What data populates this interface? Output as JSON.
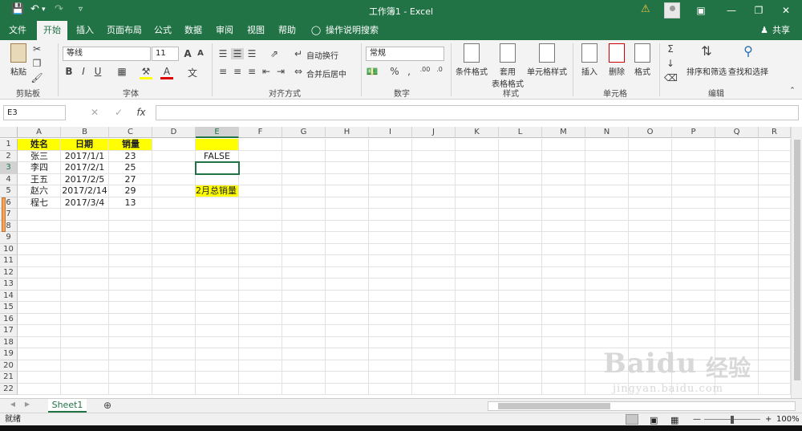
{
  "window": {
    "title": "工作簿1 - Excel"
  },
  "tabs": [
    {
      "label": "文件"
    },
    {
      "label": "开始"
    },
    {
      "label": "插入"
    },
    {
      "label": "页面布局"
    },
    {
      "label": "公式"
    },
    {
      "label": "数据"
    },
    {
      "label": "审阅"
    },
    {
      "label": "视图"
    },
    {
      "label": "帮助"
    }
  ],
  "tellme": "操作说明搜索",
  "share": "共享",
  "ribbon": {
    "paste": "粘贴",
    "clipboard": "剪贴板",
    "font_name": "等线",
    "font_size": "11",
    "font_group": "字体",
    "wrap": "自动换行",
    "merge": "合并后居中",
    "align_group": "对齐方式",
    "numfmt": "常规",
    "number_group": "数字",
    "cond_format": "条件格式",
    "table_format_1": "套用",
    "table_format_2": "表格格式",
    "cell_style": "单元格样式",
    "styles_group": "样式",
    "insert": "插入",
    "delete": "删除",
    "format": "格式",
    "cells_group": "单元格",
    "sort": "排序和筛选",
    "find": "查找和选择",
    "edit_group": "编辑"
  },
  "namebox": "E3",
  "formula": "",
  "columns": [
    "A",
    "B",
    "C",
    "D",
    "E",
    "F",
    "G",
    "H",
    "I",
    "J",
    "K",
    "L",
    "M",
    "N",
    "O",
    "P",
    "Q",
    "R"
  ],
  "rows": [
    "1",
    "2",
    "3",
    "4",
    "5",
    "6",
    "7",
    "8",
    "9",
    "10",
    "11",
    "12",
    "13",
    "14",
    "15",
    "16",
    "17",
    "18",
    "19",
    "20",
    "21",
    "22"
  ],
  "table": {
    "headers": [
      "姓名",
      "日期",
      "销量"
    ],
    "data": [
      [
        "张三",
        "2017/1/1",
        "23"
      ],
      [
        "李四",
        "2017/2/1",
        "25"
      ],
      [
        "王五",
        "2017/2/5",
        "27"
      ],
      [
        "赵六",
        "2017/2/14",
        "29"
      ],
      [
        "程七",
        "2017/3/4",
        "13"
      ]
    ]
  },
  "e2": "FALSE",
  "e5": "2月总销量",
  "sheet": "Sheet1",
  "status": "就绪",
  "zoom": "100%",
  "watermark": {
    "brand": "Baidu",
    "cn": "经验",
    "url": "jingyan.baidu.com"
  },
  "colors": {
    "accent": "#217346",
    "highlight": "#ffff00"
  }
}
